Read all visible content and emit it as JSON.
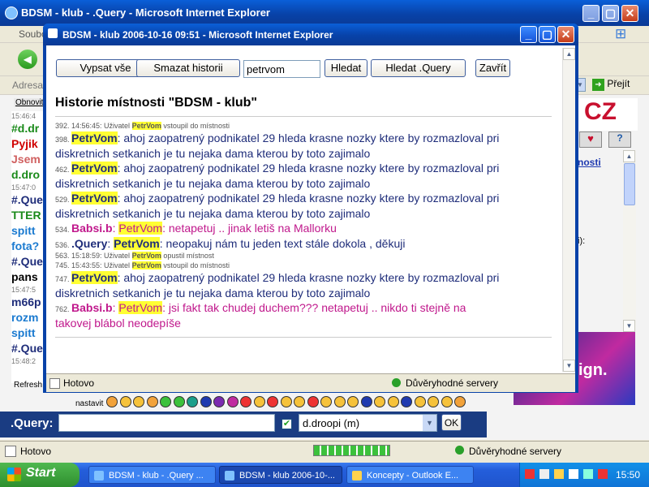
{
  "outer": {
    "title": "BDSM - klub - .Query - Microsoft Internet Explorer",
    "menu_fragment": "Soubo",
    "address_label": "Adresa",
    "go_label": "Přejít",
    "refresh_label": "Obnovit",
    "status": "Hotovo",
    "zone": "Důvěryhodné servery",
    "logo_text": "CZ",
    "link_fragment": "nosti",
    "side_fragment": "i):",
    "ad_text": "ign.",
    "refresh_bottom": "Refresh",
    "nastavit": "nastavit",
    "query_label": ".Query:",
    "query_value": "",
    "select_value": "d.droopi (m)",
    "ok_label": "OK",
    "chat_left": [
      {
        "t": "15:46:4",
        "c": "#777"
      },
      {
        "t": "#d.dr",
        "c": "#1a8a1a"
      },
      {
        "t": "Pyjik",
        "c": "#d00000"
      },
      {
        "t": "Jsem",
        "c": "#d06060"
      },
      {
        "t": "d.dro",
        "c": "#1a8a1a"
      },
      {
        "t": "15:47:0",
        "c": "#777"
      },
      {
        "t": "#.Que",
        "c": "#1f2d7a"
      },
      {
        "t": "TTER",
        "c": "#1a8a1a"
      },
      {
        "t": "spitt",
        "c": "#1a7ad0"
      },
      {
        "t": "fota?",
        "c": "#1a7ad0"
      },
      {
        "t": "#.Que",
        "c": "#1f2d7a"
      },
      {
        "t": "pans",
        "c": "#000"
      },
      {
        "t": "15:47:5",
        "c": "#777"
      },
      {
        "t": "m66p",
        "c": "#1f2d7a"
      },
      {
        "t": "rozm",
        "c": "#1a7ad0"
      },
      {
        "t": "spitt",
        "c": "#1a7ad0"
      },
      {
        "t": "#.Que",
        "c": "#1f2d7a"
      },
      {
        "t": "15:48:2",
        "c": "#777"
      }
    ]
  },
  "popup": {
    "title": "BDSM - klub 2006-10-16 09:51 - Microsoft Internet Explorer",
    "toolbar": {
      "list_all": "Vypsat vše",
      "clear_history": "Smazat historii",
      "search_value": "petrvom",
      "search": "Hledat",
      "search_query": "Hledat .Query",
      "close": "Zavřít"
    },
    "heading": "Historie místnosti \"BDSM - klub\"",
    "status": "Hotovo",
    "zone": "Důvěryhodné servery",
    "entries": [
      {
        "kind": "sys",
        "num": "392.",
        "time": "14:56:45:",
        "pre": "Uživatel",
        "name": "PetrVom",
        "post": "vstoupil do místnosti"
      },
      {
        "kind": "msg",
        "num": "398.",
        "name": "PetrVom",
        "sep": ":",
        "text": " ahoj zaopatrený podnikatel 29 hleda krasne nozky ktere by rozmazloval pri",
        "cont": "diskretnich setkanich je tu nejaka dama kterou by toto zajimalo"
      },
      {
        "kind": "msg",
        "num": "462.",
        "name": "PetrVom",
        "sep": ":",
        "text": " ahoj zaopatrený podnikatel 29 hleda krasne nozky ktere by rozmazloval pri",
        "cont": "diskretnich setkanich je tu nejaka dama kterou by toto zajimalo"
      },
      {
        "kind": "msg",
        "num": "529.",
        "name": "PetrVom",
        "sep": ":",
        "text": " ahoj zaopatrený podnikatel 29 hleda krasne nozky ktere by rozmazloval pri",
        "cont": "diskretnich setkanich je tu nejaka dama kterou by toto zajimalo"
      },
      {
        "kind": "pink",
        "num": "534.",
        "from": "Babsi.b",
        "sep": ":",
        "name": "PetrVom",
        "text": ": netapetuj .. jinak letiš na Mallorku"
      },
      {
        "kind": "reply",
        "num": "536.",
        "from": ".Query",
        "sep": ":",
        "name": "PetrVom",
        "text": ": neopakuj nám tu jeden text stále dokola , děkuji"
      },
      {
        "kind": "sys",
        "num": "563.",
        "time": "15:18:59:",
        "pre": "Uživatel",
        "name": "PetrVom",
        "post": "opustil místnost"
      },
      {
        "kind": "sys",
        "num": "745.",
        "time": "15:43:55:",
        "pre": "Uživatel",
        "name": "PetrVom",
        "post": "vstoupil do místnosti"
      },
      {
        "kind": "msg",
        "num": "747.",
        "name": "PetrVom",
        "sep": ":",
        "text": " ahoj zaopatrený podnikatel 29 hleda krasne nozky ktere by rozmazloval pri",
        "cont": "diskretnich setkanich je tu nejaka dama kterou by toto zajimalo"
      },
      {
        "kind": "pinkcont",
        "num": "762.",
        "from": "Babsi.b",
        "sep": ":",
        "name": "PetrVom",
        "text": ": jsi fakt tak chudej duchem??? netapetuj .. nikdo ti stejně na",
        "cont": "takovej blábol neodepíše"
      }
    ]
  },
  "taskbar": {
    "start": "Start",
    "clock": "15:50",
    "tasks": [
      "BDSM - klub - .Query ...",
      "BDSM - klub 2006-10-...",
      "Koncepty - Outlook E..."
    ]
  },
  "colors": {
    "accent": "#0a4fc8",
    "name_highlight": "#ffff33",
    "pink": "#c0188c",
    "name_blue": "#1f2d7a"
  }
}
